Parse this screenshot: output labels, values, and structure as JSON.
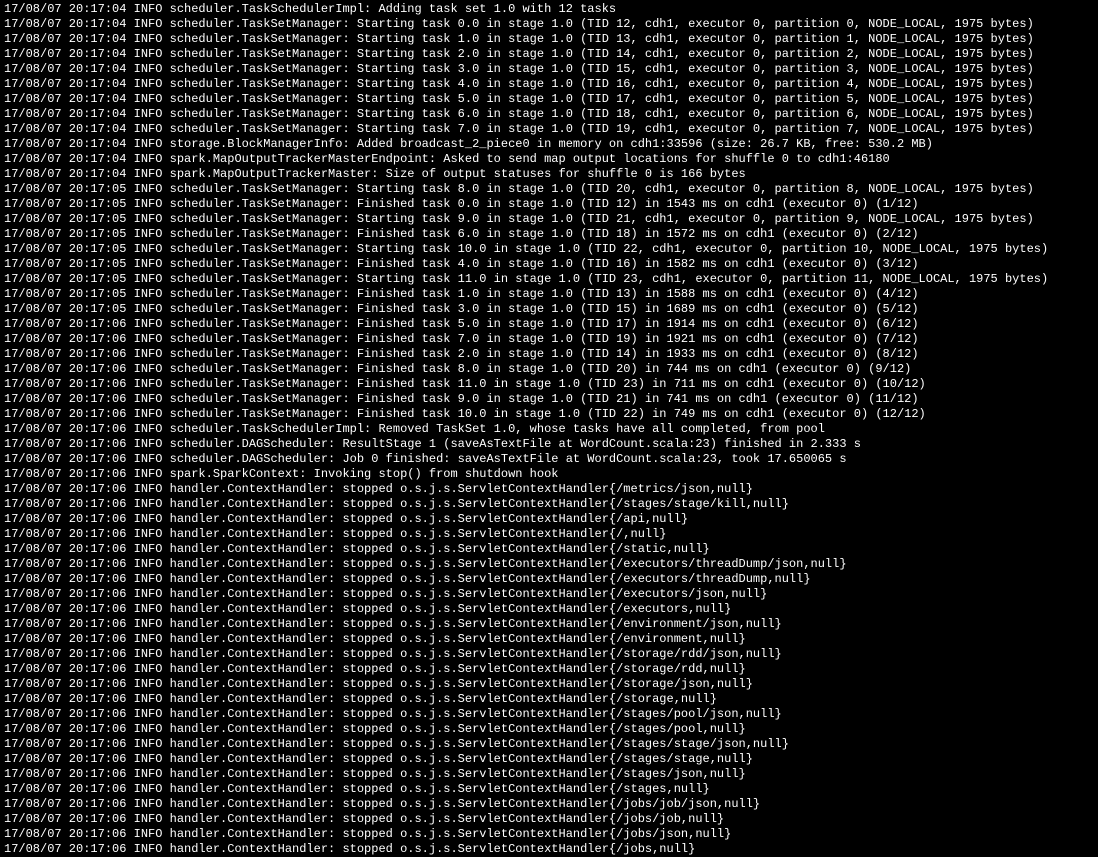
{
  "log_lines": [
    "17/08/07 20:17:04 INFO scheduler.TaskSchedulerImpl: Adding task set 1.0 with 12 tasks",
    "17/08/07 20:17:04 INFO scheduler.TaskSetManager: Starting task 0.0 in stage 1.0 (TID 12, cdh1, executor 0, partition 0, NODE_LOCAL, 1975 bytes)",
    "17/08/07 20:17:04 INFO scheduler.TaskSetManager: Starting task 1.0 in stage 1.0 (TID 13, cdh1, executor 0, partition 1, NODE_LOCAL, 1975 bytes)",
    "17/08/07 20:17:04 INFO scheduler.TaskSetManager: Starting task 2.0 in stage 1.0 (TID 14, cdh1, executor 0, partition 2, NODE_LOCAL, 1975 bytes)",
    "17/08/07 20:17:04 INFO scheduler.TaskSetManager: Starting task 3.0 in stage 1.0 (TID 15, cdh1, executor 0, partition 3, NODE_LOCAL, 1975 bytes)",
    "17/08/07 20:17:04 INFO scheduler.TaskSetManager: Starting task 4.0 in stage 1.0 (TID 16, cdh1, executor 0, partition 4, NODE_LOCAL, 1975 bytes)",
    "17/08/07 20:17:04 INFO scheduler.TaskSetManager: Starting task 5.0 in stage 1.0 (TID 17, cdh1, executor 0, partition 5, NODE_LOCAL, 1975 bytes)",
    "17/08/07 20:17:04 INFO scheduler.TaskSetManager: Starting task 6.0 in stage 1.0 (TID 18, cdh1, executor 0, partition 6, NODE_LOCAL, 1975 bytes)",
    "17/08/07 20:17:04 INFO scheduler.TaskSetManager: Starting task 7.0 in stage 1.0 (TID 19, cdh1, executor 0, partition 7, NODE_LOCAL, 1975 bytes)",
    "17/08/07 20:17:04 INFO storage.BlockManagerInfo: Added broadcast_2_piece0 in memory on cdh1:33596 (size: 26.7 KB, free: 530.2 MB)",
    "17/08/07 20:17:04 INFO spark.MapOutputTrackerMasterEndpoint: Asked to send map output locations for shuffle 0 to cdh1:46180",
    "17/08/07 20:17:04 INFO spark.MapOutputTrackerMaster: Size of output statuses for shuffle 0 is 166 bytes",
    "17/08/07 20:17:05 INFO scheduler.TaskSetManager: Starting task 8.0 in stage 1.0 (TID 20, cdh1, executor 0, partition 8, NODE_LOCAL, 1975 bytes)",
    "17/08/07 20:17:05 INFO scheduler.TaskSetManager: Finished task 0.0 in stage 1.0 (TID 12) in 1543 ms on cdh1 (executor 0) (1/12)",
    "17/08/07 20:17:05 INFO scheduler.TaskSetManager: Starting task 9.0 in stage 1.0 (TID 21, cdh1, executor 0, partition 9, NODE_LOCAL, 1975 bytes)",
    "17/08/07 20:17:05 INFO scheduler.TaskSetManager: Finished task 6.0 in stage 1.0 (TID 18) in 1572 ms on cdh1 (executor 0) (2/12)",
    "17/08/07 20:17:05 INFO scheduler.TaskSetManager: Starting task 10.0 in stage 1.0 (TID 22, cdh1, executor 0, partition 10, NODE_LOCAL, 1975 bytes)",
    "17/08/07 20:17:05 INFO scheduler.TaskSetManager: Finished task 4.0 in stage 1.0 (TID 16) in 1582 ms on cdh1 (executor 0) (3/12)",
    "17/08/07 20:17:05 INFO scheduler.TaskSetManager: Starting task 11.0 in stage 1.0 (TID 23, cdh1, executor 0, partition 11, NODE_LOCAL, 1975 bytes)",
    "17/08/07 20:17:05 INFO scheduler.TaskSetManager: Finished task 1.0 in stage 1.0 (TID 13) in 1588 ms on cdh1 (executor 0) (4/12)",
    "17/08/07 20:17:05 INFO scheduler.TaskSetManager: Finished task 3.0 in stage 1.0 (TID 15) in 1689 ms on cdh1 (executor 0) (5/12)",
    "17/08/07 20:17:06 INFO scheduler.TaskSetManager: Finished task 5.0 in stage 1.0 (TID 17) in 1914 ms on cdh1 (executor 0) (6/12)",
    "17/08/07 20:17:06 INFO scheduler.TaskSetManager: Finished task 7.0 in stage 1.0 (TID 19) in 1921 ms on cdh1 (executor 0) (7/12)",
    "17/08/07 20:17:06 INFO scheduler.TaskSetManager: Finished task 2.0 in stage 1.0 (TID 14) in 1933 ms on cdh1 (executor 0) (8/12)",
    "17/08/07 20:17:06 INFO scheduler.TaskSetManager: Finished task 8.0 in stage 1.0 (TID 20) in 744 ms on cdh1 (executor 0) (9/12)",
    "17/08/07 20:17:06 INFO scheduler.TaskSetManager: Finished task 11.0 in stage 1.0 (TID 23) in 711 ms on cdh1 (executor 0) (10/12)",
    "17/08/07 20:17:06 INFO scheduler.TaskSetManager: Finished task 9.0 in stage 1.0 (TID 21) in 741 ms on cdh1 (executor 0) (11/12)",
    "17/08/07 20:17:06 INFO scheduler.TaskSetManager: Finished task 10.0 in stage 1.0 (TID 22) in 749 ms on cdh1 (executor 0) (12/12)",
    "17/08/07 20:17:06 INFO scheduler.TaskSchedulerImpl: Removed TaskSet 1.0, whose tasks have all completed, from pool",
    "17/08/07 20:17:06 INFO scheduler.DAGScheduler: ResultStage 1 (saveAsTextFile at WordCount.scala:23) finished in 2.333 s",
    "17/08/07 20:17:06 INFO scheduler.DAGScheduler: Job 0 finished: saveAsTextFile at WordCount.scala:23, took 17.650065 s",
    "17/08/07 20:17:06 INFO spark.SparkContext: Invoking stop() from shutdown hook",
    "17/08/07 20:17:06 INFO handler.ContextHandler: stopped o.s.j.s.ServletContextHandler{/metrics/json,null}",
    "17/08/07 20:17:06 INFO handler.ContextHandler: stopped o.s.j.s.ServletContextHandler{/stages/stage/kill,null}",
    "17/08/07 20:17:06 INFO handler.ContextHandler: stopped o.s.j.s.ServletContextHandler{/api,null}",
    "17/08/07 20:17:06 INFO handler.ContextHandler: stopped o.s.j.s.ServletContextHandler{/,null}",
    "17/08/07 20:17:06 INFO handler.ContextHandler: stopped o.s.j.s.ServletContextHandler{/static,null}",
    "17/08/07 20:17:06 INFO handler.ContextHandler: stopped o.s.j.s.ServletContextHandler{/executors/threadDump/json,null}",
    "17/08/07 20:17:06 INFO handler.ContextHandler: stopped o.s.j.s.ServletContextHandler{/executors/threadDump,null}",
    "17/08/07 20:17:06 INFO handler.ContextHandler: stopped o.s.j.s.ServletContextHandler{/executors/json,null}",
    "17/08/07 20:17:06 INFO handler.ContextHandler: stopped o.s.j.s.ServletContextHandler{/executors,null}",
    "17/08/07 20:17:06 INFO handler.ContextHandler: stopped o.s.j.s.ServletContextHandler{/environment/json,null}",
    "17/08/07 20:17:06 INFO handler.ContextHandler: stopped o.s.j.s.ServletContextHandler{/environment,null}",
    "17/08/07 20:17:06 INFO handler.ContextHandler: stopped o.s.j.s.ServletContextHandler{/storage/rdd/json,null}",
    "17/08/07 20:17:06 INFO handler.ContextHandler: stopped o.s.j.s.ServletContextHandler{/storage/rdd,null}",
    "17/08/07 20:17:06 INFO handler.ContextHandler: stopped o.s.j.s.ServletContextHandler{/storage/json,null}",
    "17/08/07 20:17:06 INFO handler.ContextHandler: stopped o.s.j.s.ServletContextHandler{/storage,null}",
    "17/08/07 20:17:06 INFO handler.ContextHandler: stopped o.s.j.s.ServletContextHandler{/stages/pool/json,null}",
    "17/08/07 20:17:06 INFO handler.ContextHandler: stopped o.s.j.s.ServletContextHandler{/stages/pool,null}",
    "17/08/07 20:17:06 INFO handler.ContextHandler: stopped o.s.j.s.ServletContextHandler{/stages/stage/json,null}",
    "17/08/07 20:17:06 INFO handler.ContextHandler: stopped o.s.j.s.ServletContextHandler{/stages/stage,null}",
    "17/08/07 20:17:06 INFO handler.ContextHandler: stopped o.s.j.s.ServletContextHandler{/stages/json,null}",
    "17/08/07 20:17:06 INFO handler.ContextHandler: stopped o.s.j.s.ServletContextHandler{/stages,null}",
    "17/08/07 20:17:06 INFO handler.ContextHandler: stopped o.s.j.s.ServletContextHandler{/jobs/job/json,null}",
    "17/08/07 20:17:06 INFO handler.ContextHandler: stopped o.s.j.s.ServletContextHandler{/jobs/job,null}",
    "17/08/07 20:17:06 INFO handler.ContextHandler: stopped o.s.j.s.ServletContextHandler{/jobs/json,null}",
    "17/08/07 20:17:06 INFO handler.ContextHandler: stopped o.s.j.s.ServletContextHandler{/jobs,null}"
  ]
}
